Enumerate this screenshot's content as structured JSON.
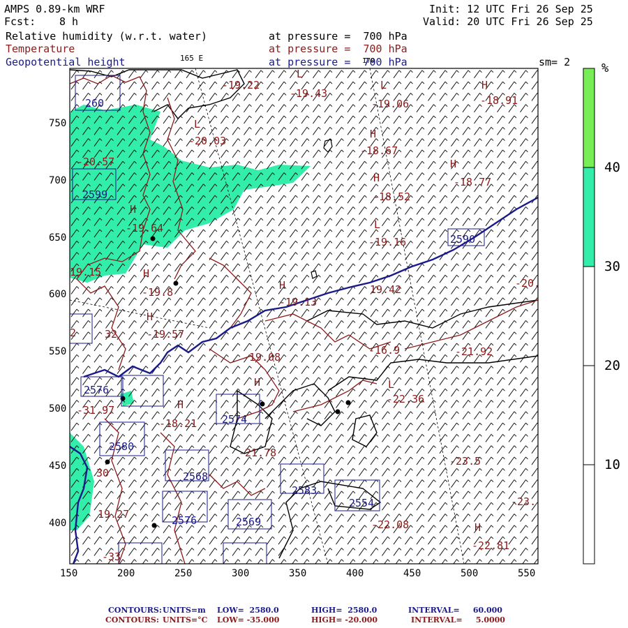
{
  "header": {
    "model": "AMPS 0.89-km WRF",
    "init": "Init: 12 UTC Fri 26 Sep 25",
    "fcst_label": "Fcst:",
    "fcst_value": "8 h",
    "valid": "Valid: 20 UTC Fri 26 Sep 25",
    "rh_label": "Relative humidity (w.r.t. water)",
    "rh_level": "at pressure =  700 hPa",
    "temp_label": "Temperature",
    "temp_level": "at pressure =  700 hPa",
    "geo_label": "Geopotential height",
    "geo_level": "at pressure =  700 hPa",
    "lon_165": "165 E",
    "lon_170": "170",
    "sm": "sm= 2"
  },
  "colors": {
    "rh_fill": "#33eeaa",
    "colorbar_top": "#77ee55",
    "temperature": "#8b1a1a",
    "geopotential": "#1a1a8b"
  },
  "colorbar": {
    "unit": "%",
    "labels": [
      "40",
      "30",
      "20",
      "10"
    ],
    "bands": [
      {
        "from": 40,
        "to": 50,
        "color": "#77ee55"
      },
      {
        "from": 30,
        "to": 40,
        "color": "#33eeaa"
      },
      {
        "from": 0,
        "to": 30,
        "color": "#ffffff"
      }
    ]
  },
  "axes": {
    "x_ticks": [
      "150",
      "200",
      "250",
      "300",
      "350",
      "400",
      "450",
      "500",
      "550"
    ],
    "y_ticks": [
      "750",
      "700",
      "650",
      "600",
      "550",
      "500",
      "450",
      "400"
    ]
  },
  "map_labels": [
    {
      "text": "-19.22",
      "kind": "temp"
    },
    {
      "text": "L",
      "kind": "temp"
    },
    {
      "text": "-19.43",
      "kind": "temp"
    },
    {
      "text": "L",
      "kind": "temp"
    },
    {
      "text": "-19.06",
      "kind": "temp"
    },
    {
      "text": "H",
      "kind": "temp"
    },
    {
      "text": "-18.91",
      "kind": "temp"
    },
    {
      "text": "260",
      "kind": "geo"
    },
    {
      "text": "L",
      "kind": "temp"
    },
    {
      "text": "-20.03",
      "kind": "temp"
    },
    {
      "text": "H",
      "kind": "temp"
    },
    {
      "text": "-18.67",
      "kind": "temp"
    },
    {
      "text": "-20.57",
      "kind": "temp"
    },
    {
      "text": "H",
      "kind": "temp"
    },
    {
      "text": "-18.77",
      "kind": "temp"
    },
    {
      "text": "2599",
      "kind": "geo"
    },
    {
      "text": "H",
      "kind": "temp"
    },
    {
      "text": "-18.52",
      "kind": "temp"
    },
    {
      "text": "H",
      "kind": "temp"
    },
    {
      "text": "-19.64",
      "kind": "temp"
    },
    {
      "text": "L",
      "kind": "temp"
    },
    {
      "text": "-19.16",
      "kind": "temp"
    },
    {
      "text": "2590",
      "kind": "geo"
    },
    {
      "text": "19.15",
      "kind": "temp"
    },
    {
      "text": "H",
      "kind": "temp"
    },
    {
      "text": "-19.8",
      "kind": "temp"
    },
    {
      "text": "H",
      "kind": "temp"
    },
    {
      "text": "-19.13",
      "kind": "temp"
    },
    {
      "text": "19.42",
      "kind": "temp"
    },
    {
      "text": "-20.",
      "kind": "temp"
    },
    {
      "text": "H",
      "kind": "temp"
    },
    {
      "text": "-19.57",
      "kind": "temp"
    },
    {
      "text": "2",
      "kind": "temp"
    },
    {
      "text": "32",
      "kind": "temp"
    },
    {
      "text": "-16.9",
      "kind": "temp"
    },
    {
      "text": "-21.92",
      "kind": "temp"
    },
    {
      "text": "-19.08",
      "kind": "temp"
    },
    {
      "text": "2576",
      "kind": "geo"
    },
    {
      "text": "L",
      "kind": "temp"
    },
    {
      "text": "-22.36",
      "kind": "temp"
    },
    {
      "text": "-31.97",
      "kind": "temp"
    },
    {
      "text": "H",
      "kind": "temp"
    },
    {
      "text": "-18.21",
      "kind": "temp"
    },
    {
      "text": "H",
      "kind": "temp"
    },
    {
      "text": "2574",
      "kind": "geo"
    },
    {
      "text": "2580",
      "kind": "geo"
    },
    {
      "text": "-21.78",
      "kind": "temp"
    },
    {
      "text": "2568",
      "kind": "geo"
    },
    {
      "text": "-23.5",
      "kind": "temp"
    },
    {
      "text": "2583",
      "kind": "geo"
    },
    {
      "text": "2554",
      "kind": "geo"
    },
    {
      "text": "-23.",
      "kind": "temp"
    },
    {
      "text": "2576",
      "kind": "geo"
    },
    {
      "text": "-22.08",
      "kind": "temp"
    },
    {
      "text": "2569",
      "kind": "geo"
    },
    {
      "text": "H",
      "kind": "temp"
    },
    {
      "text": "-22.81",
      "kind": "temp"
    },
    {
      "text": "19.27",
      "kind": "temp"
    },
    {
      "text": "-33",
      "kind": "temp"
    },
    {
      "text": "30",
      "kind": "temp"
    }
  ],
  "footer": {
    "line1_label": "CONTOURS:",
    "line1_units": "UNITS=m",
    "line1_low": "LOW=  2580.0",
    "line1_high": "HIGH=  2580.0",
    "line1_interval": "INTERVAL=     60.000",
    "line2_label": "CONTOURS:",
    "line2_units": "UNITS=°C",
    "line2_low": "LOW= -35.000",
    "line2_high": "HIGH= -20.000",
    "line2_interval": "INTERVAL=     5.0000"
  }
}
